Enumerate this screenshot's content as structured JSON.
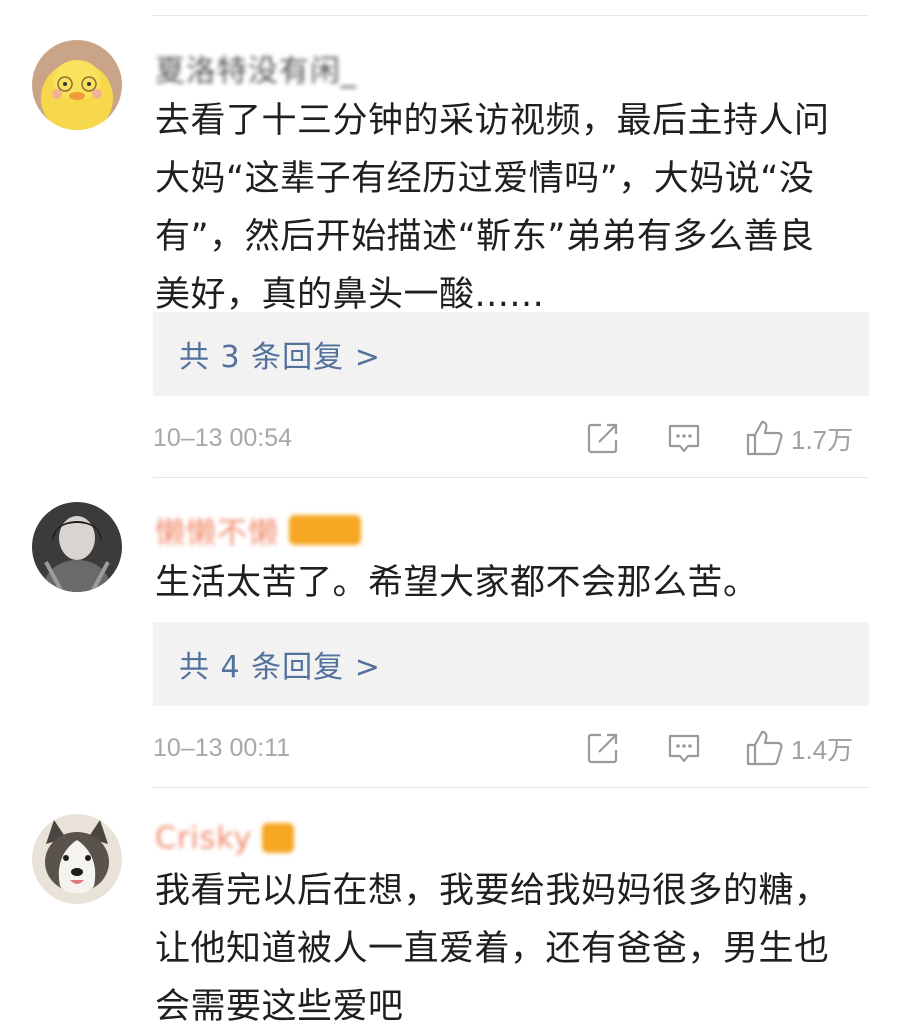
{
  "comments": [
    {
      "username": "夏洛特没有闲_",
      "text": "去看了十三分钟的采访视频，最后主持人问\n大妈“这辈子有经历过爱情吗”，大妈说“没\n有”，然后开始描述“靳东”弟弟有多么善良\n美好，真的鼻头一酸......",
      "replies_label": "共 3 条回复 >",
      "time": "10–13 00:54",
      "likes": "1.7万",
      "avatar_icon": "yellow-duck-avatar"
    },
    {
      "username": "懒懒不懒",
      "text": "生活太苦了。希望大家都不会那么苦。",
      "replies_label": "共 4 条回复 >",
      "time": "10–13 00:11",
      "likes": "1.4万",
      "avatar_icon": "girl-photo-avatar"
    },
    {
      "username": "Crisky",
      "text": "我看完以后在想，我要给我妈妈很多的糖，\n让他知道被人一直爱着，还有爸爸，男生也\n会需要这些爱吧",
      "avatar_icon": "husky-dog-avatar"
    }
  ],
  "icons": {
    "share": "share-icon",
    "comment": "comment-icon",
    "like": "thumbs-up-icon"
  },
  "colors": {
    "link": "#53719b",
    "meta": "#a8a8a8",
    "reply_box": "#f2f2f2",
    "badge": "#f5a623"
  }
}
